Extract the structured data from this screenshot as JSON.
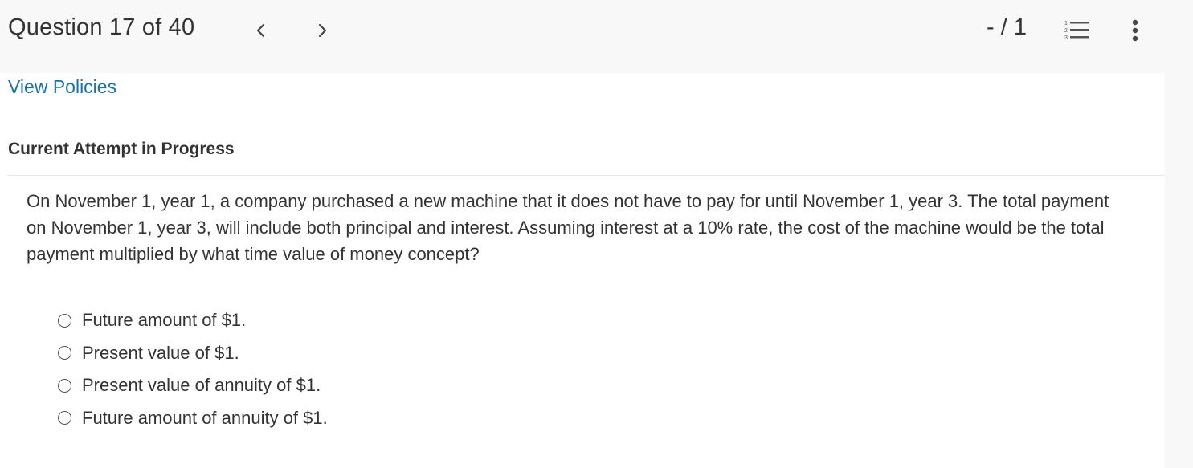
{
  "header": {
    "question_counter": "Question 17 of 40",
    "score": "- / 1",
    "prev_icon": "chevron-left-icon",
    "next_icon": "chevron-right-icon",
    "list_icon": "numbered-list-icon",
    "more_icon": "vertical-ellipsis-icon"
  },
  "content": {
    "policies_link": "View Policies",
    "attempt_heading": "Current Attempt in Progress",
    "question_text": "On November 1, year 1, a company purchased a new machine that it does not have to pay for until November 1, year 3. The total payment on November 1, year 3, will include both principal and interest. Assuming interest at a 10% rate, the cost of the machine would be the total payment multiplied by what time value of money concept?",
    "options": [
      "Future amount of $1.",
      "Present value of $1.",
      "Present value of annuity of $1.",
      "Future amount of annuity of $1."
    ]
  },
  "colors": {
    "link": "#1a73a8",
    "text": "#333333",
    "header_bg": "#f8f8f8",
    "content_bg": "#ffffff"
  }
}
